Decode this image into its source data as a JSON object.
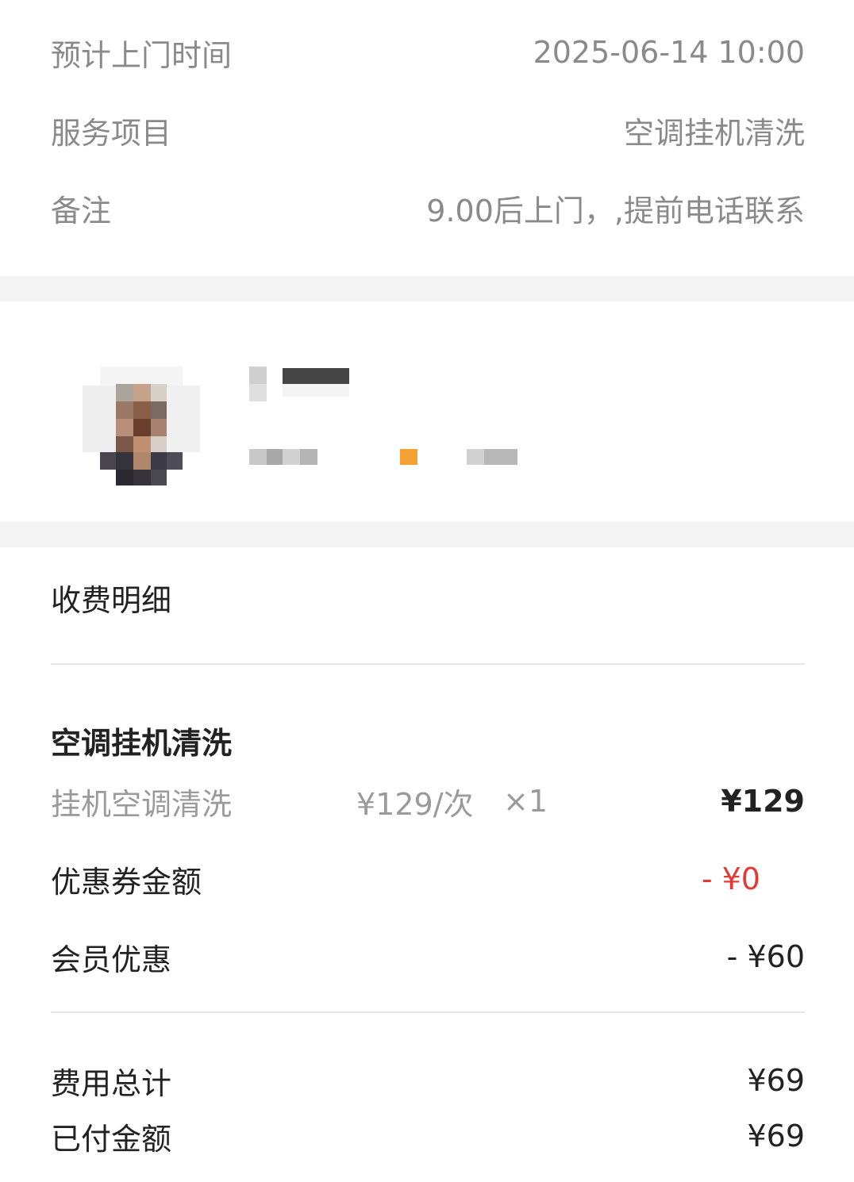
{
  "info": {
    "visit_time_label": "预计上门时间",
    "visit_time_value": "2025-06-14 10:00",
    "service_label": "服务项目",
    "service_value": "空调挂机清洗",
    "remark_label": "备注",
    "remark_value": "9.00后上门，,提前电话联系"
  },
  "fee": {
    "section_title": "收费明细",
    "group_title": "空调挂机清洗",
    "item": {
      "name": "挂机空调清洗",
      "unit_price": "¥129/次",
      "quantity": "×1",
      "amount": "¥129"
    },
    "coupon_label": "优惠券金额",
    "coupon_value": "- ¥0",
    "member_label": "会员优惠",
    "member_value": "- ¥60",
    "total_label": "费用总计",
    "total_value": "¥69",
    "paid_label": "已付金额",
    "paid_value": "¥69"
  },
  "colors": {
    "accent_red": "#e53935",
    "grey_text": "#8a8a8a",
    "badge_orange": "#f5a033"
  }
}
